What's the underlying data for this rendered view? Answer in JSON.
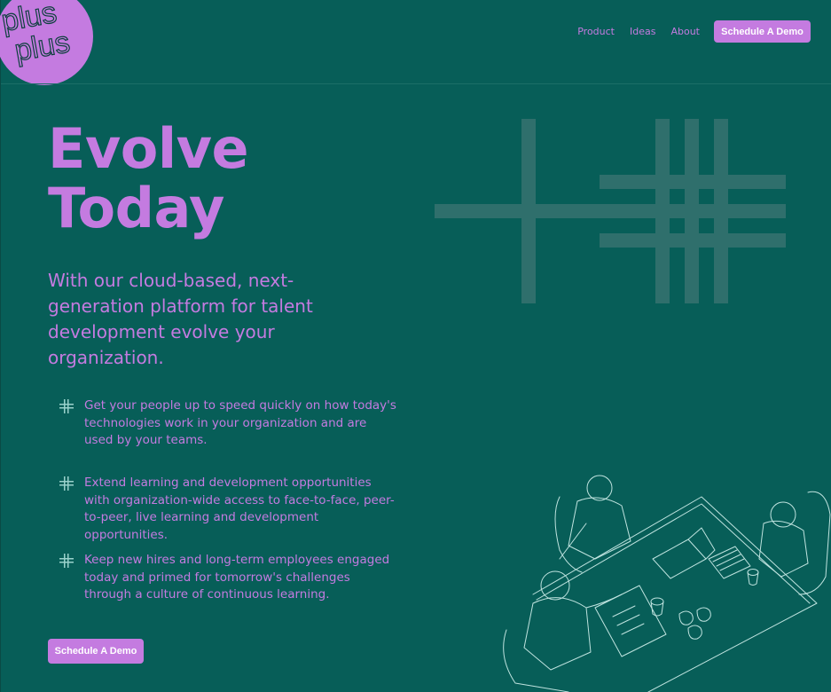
{
  "brand": {
    "logo_text": "plus plus"
  },
  "nav": {
    "items": [
      {
        "label": "Product"
      },
      {
        "label": "Ideas"
      },
      {
        "label": "About"
      }
    ],
    "cta_label": "Schedule A Demo"
  },
  "hero": {
    "title_line1": "Evolve",
    "title_line2": "Today",
    "subtitle": "With our cloud-based, next-generation platform for talent development evolve your organization."
  },
  "features": [
    {
      "icon": "plus-grid-icon",
      "text": "Get your people up to speed quickly on how today's technologies work in your organization and are used by your teams."
    },
    {
      "icon": "plus-grid-icon",
      "text": "Extend learning and development opportunities with organization-wide access to face-to-face, peer-to-peer, live learning and development opportunities."
    },
    {
      "icon": "plus-grid-icon",
      "text": "Keep new hires and long-term employees engaged today and primed for tomorrow's challenges through a culture of continuous learning."
    }
  ],
  "cta": {
    "label": "Schedule A Demo"
  },
  "colors": {
    "background": "#075e58",
    "accent": "#c47be0",
    "decor": "#2f6f6c",
    "line_art": "#bfe3df"
  }
}
